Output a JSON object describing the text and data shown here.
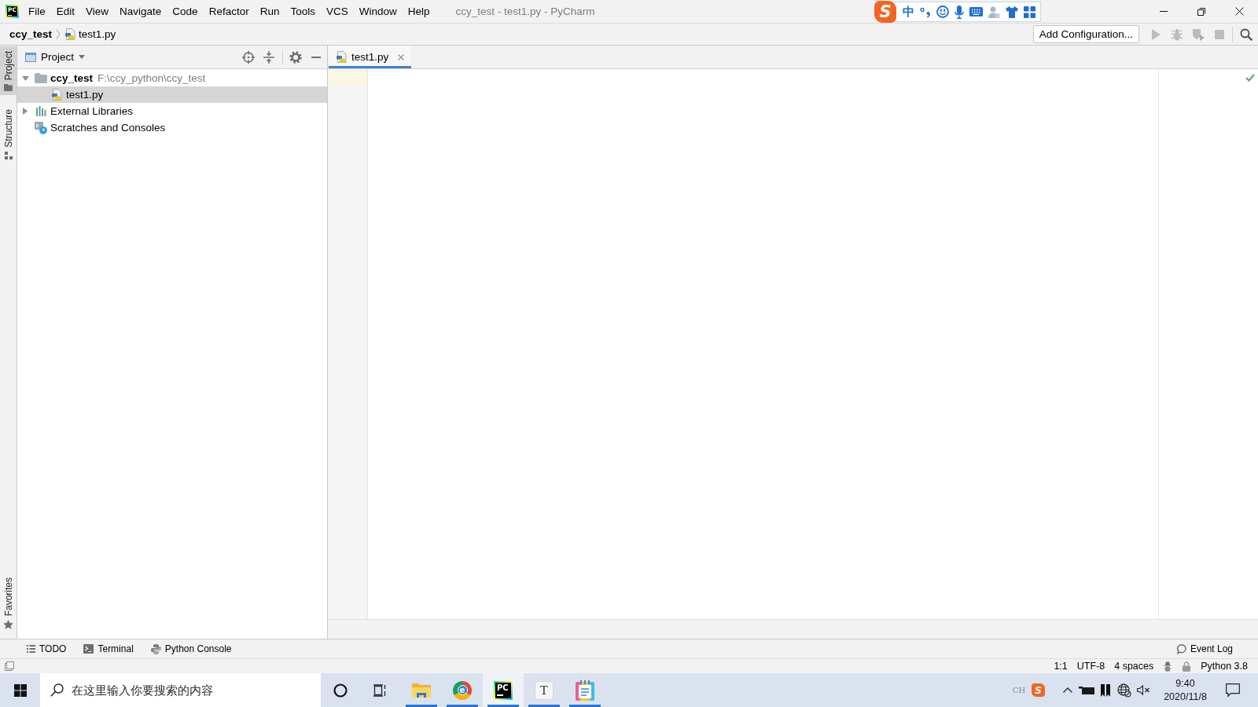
{
  "window": {
    "title": "ccy_test - test1.py - PyCharm",
    "logo": "PC"
  },
  "menu": [
    "File",
    "Edit",
    "View",
    "Navigate",
    "Code",
    "Refactor",
    "Run",
    "Tools",
    "VCS",
    "Window",
    "Help"
  ],
  "ime_toolbar": {
    "logo": "S",
    "mode": "中"
  },
  "navigation_bar": {
    "breadcrumbs": [
      {
        "label": "ccy_test",
        "kind": "project"
      },
      {
        "label": "test1.py",
        "kind": "python_file"
      }
    ],
    "run_configuration": "Add Configuration...",
    "run_buttons": [
      {
        "kind": "run",
        "disabled": true
      },
      {
        "kind": "debug",
        "disabled": true
      },
      {
        "kind": "coverage",
        "disabled": true
      },
      {
        "kind": "stop",
        "disabled": true
      }
    ]
  },
  "tool_strip": {
    "top": [
      {
        "label": "Project",
        "kind": "project",
        "selected": true
      },
      {
        "label": "Structure",
        "kind": "structure",
        "selected": false
      }
    ],
    "bottom": [
      {
        "label": "Favorites",
        "kind": "favorites",
        "selected": false
      }
    ]
  },
  "project_panel": {
    "title": "Project",
    "tree": [
      {
        "label": "ccy_test",
        "kind": "project",
        "path": "F:\\ccy_python\\ccy_test",
        "expanded": true,
        "selected": false,
        "children": [
          {
            "label": "test1.py",
            "kind": "python_file",
            "selected": true
          }
        ]
      },
      {
        "label": "External Libraries",
        "kind": "libraries",
        "expanded": false,
        "selected": false
      },
      {
        "label": "Scratches and Consoles",
        "kind": "scratches",
        "selected": false
      }
    ]
  },
  "editor": {
    "tabs": [
      {
        "label": "test1.py",
        "kind": "python_file",
        "selected": true
      }
    ]
  },
  "tool_window_bar": {
    "left": [
      {
        "label": "TODO",
        "kind": "todo"
      },
      {
        "label": "Terminal",
        "kind": "terminal"
      },
      {
        "label": "Python Console",
        "kind": "python_console"
      }
    ],
    "right": [
      {
        "label": "Event Log",
        "kind": "event_log"
      }
    ]
  },
  "status_bar": {
    "items": [
      "1:1",
      "UTF-8",
      "4 spaces"
    ],
    "interpreter": "Python 3.8"
  },
  "taskbar": {
    "search": {
      "placeholder": "在这里输入你要搜索的内容"
    },
    "apps": [
      {
        "kind": "files",
        "running": true,
        "selected": false
      },
      {
        "kind": "browser",
        "glyph": "e",
        "running": true,
        "selected": false
      },
      {
        "kind": "ide",
        "glyph": "PC",
        "running": true,
        "selected": true
      },
      {
        "kind": "text",
        "glyph": "T",
        "running": true,
        "selected": false
      },
      {
        "kind": "notes",
        "running": true,
        "selected": false
      }
    ],
    "tray": {
      "input_language": "CH",
      "ime_logo": "S",
      "time": "9:40",
      "date": "2020/11/8"
    }
  }
}
